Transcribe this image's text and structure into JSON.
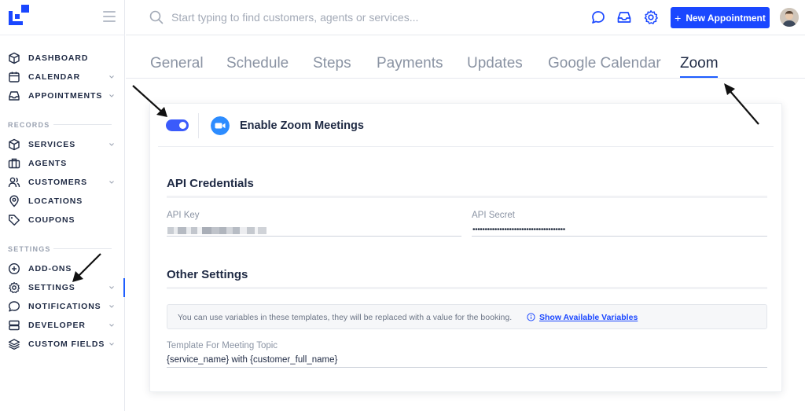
{
  "sidebar": {
    "items_main": [
      {
        "label": "DASHBOARD",
        "icon": "cube-icon",
        "chevron": false
      },
      {
        "label": "CALENDAR",
        "icon": "calendar-icon",
        "chevron": true
      },
      {
        "label": "APPOINTMENTS",
        "icon": "inbox-icon",
        "chevron": true
      }
    ],
    "section_records": "RECORDS",
    "items_records": [
      {
        "label": "SERVICES",
        "icon": "cube-icon",
        "chevron": true
      },
      {
        "label": "AGENTS",
        "icon": "briefcase-icon",
        "chevron": false
      },
      {
        "label": "CUSTOMERS",
        "icon": "users-icon",
        "chevron": true
      },
      {
        "label": "LOCATIONS",
        "icon": "map-pin-icon",
        "chevron": false
      },
      {
        "label": "COUPONS",
        "icon": "tag-icon",
        "chevron": false
      }
    ],
    "section_settings": "SETTINGS",
    "items_settings": [
      {
        "label": "ADD-ONS",
        "icon": "plus-circle-icon",
        "chevron": false
      },
      {
        "label": "SETTINGS",
        "icon": "gear-icon",
        "chevron": true,
        "active": true
      },
      {
        "label": "NOTIFICATIONS",
        "icon": "chat-bubble-icon",
        "chevron": true
      },
      {
        "label": "DEVELOPER",
        "icon": "server-icon",
        "chevron": true
      },
      {
        "label": "CUSTOM FIELDS",
        "icon": "layers-icon",
        "chevron": true
      }
    ]
  },
  "topbar": {
    "search_placeholder": "Start typing to find customers, agents or services...",
    "new_appointment_label": "New Appointment"
  },
  "tabs": [
    {
      "label": "General",
      "active": false
    },
    {
      "label": "Schedule",
      "active": false
    },
    {
      "label": "Steps",
      "active": false
    },
    {
      "label": "Payments",
      "active": false
    },
    {
      "label": "Updates",
      "active": false
    },
    {
      "label": "Google Calendar",
      "active": false
    },
    {
      "label": "Zoom",
      "active": true
    }
  ],
  "zoom": {
    "enable_label": "Enable Zoom Meetings",
    "enabled": true,
    "api_credentials_title": "API Credentials",
    "api_key_label": "API Key",
    "api_secret_label": "API Secret",
    "api_secret_value": "••••••••••••••••••••••••••••••••••••••",
    "other_settings_title": "Other Settings",
    "info_text": "You can use variables in these templates, they will be replaced with a value for the booking.",
    "info_link": "Show Available Variables",
    "template_label": "Template For Meeting Topic",
    "template_value": "{service_name} with {customer_full_name}"
  },
  "colors": {
    "accent": "#1a47ff",
    "toggle_on": "#3b5bfb",
    "zoom_blue": "#2d8cff"
  }
}
